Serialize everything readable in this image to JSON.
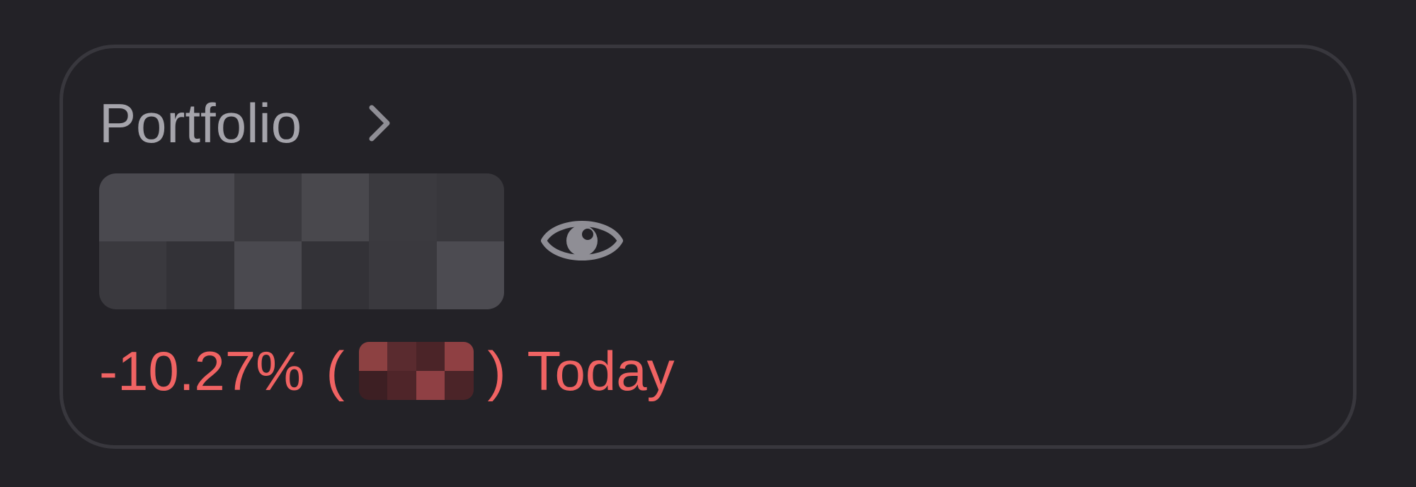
{
  "portfolio": {
    "title": "Portfolio",
    "chevron_icon": "chevron-right-icon",
    "balance_hidden_icon": "pixelated-mask",
    "visibility_icon": "eye-icon",
    "change": {
      "percent": "-10.27%",
      "open_paren": "(",
      "close_paren": ")",
      "period": "Today",
      "color": "#f06363"
    }
  },
  "colors": {
    "background": "#232227",
    "card_border": "#38373d",
    "title": "#a5a4ab",
    "negative": "#f06363",
    "icon": "#8f8e95"
  }
}
